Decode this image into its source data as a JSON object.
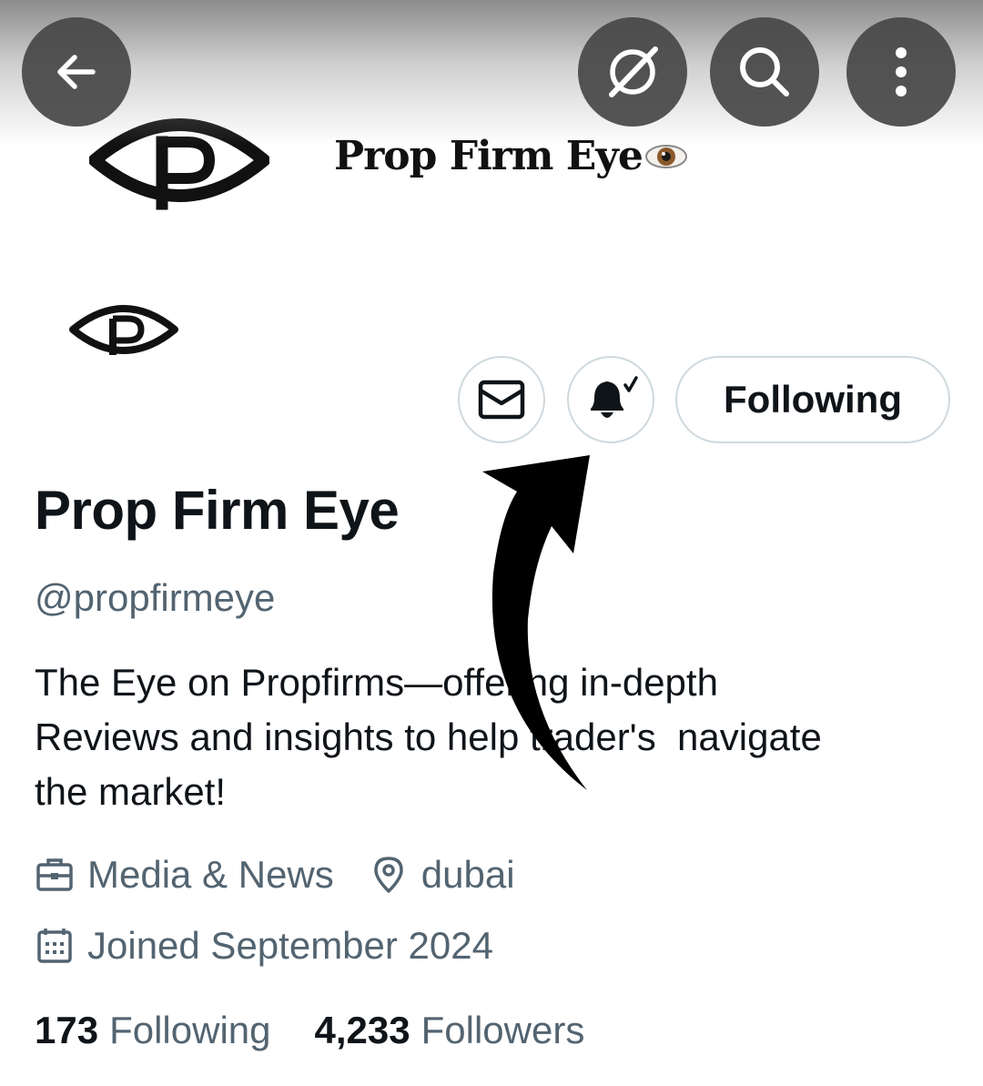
{
  "banner": {
    "title": "Prop Firm Eye"
  },
  "top_bar": {
    "back_icon": "arrow-left-icon",
    "grok_icon": "grok-icon",
    "search_icon": "search-icon",
    "more_icon": "more-vertical-icon"
  },
  "actions": {
    "message_icon": "envelope-icon",
    "notify_icon": "bell-check-icon",
    "follow_label": "Following"
  },
  "profile": {
    "display_name": "Prop Firm Eye",
    "handle": "@propfirmeye",
    "bio_lines": [
      "The Eye on Propfirms—offering in-depth",
      "Reviews and insights to help trader's  navigate",
      "the market!"
    ],
    "category": "Media & News",
    "location": "dubai",
    "joined": "Joined September 2024"
  },
  "stats": {
    "following_count": "173",
    "following_label": "Following",
    "followers_count": "4,233",
    "followers_label": "Followers"
  },
  "colors": {
    "text_primary": "#0f1419",
    "text_secondary": "#536471",
    "border": "#cfd9de",
    "overlay_button": "#464646"
  }
}
